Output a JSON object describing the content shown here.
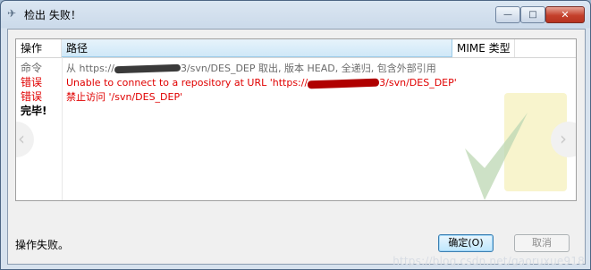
{
  "window": {
    "title": "检出 失败！",
    "icon": "svn-app-icon",
    "controls": {
      "minimize": "—",
      "maximize": "□",
      "close": "✕"
    }
  },
  "table": {
    "columns": [
      "操作",
      "路径",
      "MIME 类型"
    ],
    "rows": [
      {
        "op": "命令",
        "op_color": "#6a6a6a",
        "path_pre": "从 https://",
        "path_post": "3/svn/DES_DEP 取出, 版本 HEAD, 全递归, 包含外部引用",
        "path_color": "#6a6a6a"
      },
      {
        "op": "错误",
        "op_color": "#e00000",
        "path_pre": "Unable to connect to a repository at URL 'https://",
        "path_post": "3/svn/DES_DEP'",
        "path_color": "#e00000"
      },
      {
        "op": "错误",
        "op_color": "#e00000",
        "path": "禁止访问 '/svn/DES_DEP'",
        "path_color": "#e00000"
      },
      {
        "op": "完毕!",
        "op_color": "#000000",
        "path": ""
      }
    ]
  },
  "status_text": "操作失败。",
  "buttons": {
    "ok": "确定(O)",
    "cancel": "取消"
  },
  "watermark": "https://blog.csdn.net/gaoruxue918"
}
